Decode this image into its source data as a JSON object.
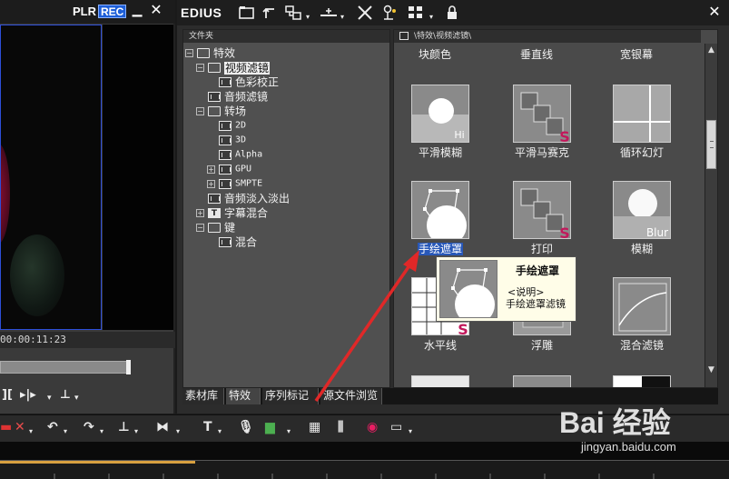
{
  "player": {
    "plr_label": "PLR",
    "rec_label": "REC",
    "timecode": "00:00:11:23",
    "progress_fraction": 0.76
  },
  "app": {
    "title": "EDIUS"
  },
  "folder_panel": {
    "header": "文件夹",
    "tree": [
      {
        "label": "特效",
        "icon": "folder-icon",
        "level": 0,
        "toggle": "−"
      },
      {
        "label": "视频滤镜",
        "icon": "folder-icon",
        "level": 1,
        "toggle": "−",
        "selected": true
      },
      {
        "label": "色彩校正",
        "icon": "film-icon",
        "level": 2
      },
      {
        "label": "音频滤镜",
        "icon": "film-icon",
        "level": 1
      },
      {
        "label": "转场",
        "icon": "folder-icon",
        "level": 1,
        "toggle": "−"
      },
      {
        "label": "2D",
        "icon": "film-icon",
        "level": 2
      },
      {
        "label": "3D",
        "icon": "film-icon",
        "level": 2
      },
      {
        "label": "Alpha",
        "icon": "film-icon",
        "level": 2
      },
      {
        "label": "GPU",
        "icon": "film-icon",
        "level": 2,
        "toggle": "+"
      },
      {
        "label": "SMPTE",
        "icon": "film-icon",
        "level": 2,
        "toggle": "+"
      },
      {
        "label": "音频淡入淡出",
        "icon": "film-icon",
        "level": 1
      },
      {
        "label": "字幕混合",
        "icon": "text-icon",
        "level": 1,
        "toggle": "+"
      },
      {
        "label": "键",
        "icon": "folder-icon",
        "level": 1,
        "toggle": "−"
      },
      {
        "label": "混合",
        "icon": "film-icon",
        "level": 2
      }
    ]
  },
  "effects_panel": {
    "header": "\\特效\\视频滤镜\\",
    "top_labels": [
      "块颜色",
      "垂直线",
      "宽银幕"
    ],
    "effects": [
      {
        "label": "平滑模糊",
        "thumb": "hi"
      },
      {
        "label": "平滑马赛克",
        "thumb": "squares-s"
      },
      {
        "label": "循环幻灯",
        "thumb": "grid"
      },
      {
        "label": "手绘遮罩",
        "thumb": "drawn-mask",
        "selected": true
      },
      {
        "label": "打印",
        "thumb": "squares-s"
      },
      {
        "label": "模糊",
        "thumb": "blur"
      },
      {
        "label": "水平线",
        "thumb": "lines-s"
      },
      {
        "label": "浮雕",
        "thumb": "emboss"
      },
      {
        "label": "混合滤镜",
        "thumb": "curve"
      }
    ],
    "thumb_text": {
      "hi": "Hi",
      "blur": "Blur",
      "s": "S"
    }
  },
  "tooltip": {
    "title": "手绘遮罩",
    "caption": "<说明>",
    "description": "手绘遮罩滤镜"
  },
  "tabs": [
    "素材库",
    "特效",
    "序列标记",
    "源文件浏览"
  ],
  "active_tab": 1,
  "watermark": {
    "logo": "Bai 经验",
    "url": "jingyan.baidu.com"
  },
  "colors": {
    "rec_badge": "#1e5fd8",
    "selection": "#2858b8",
    "arrow": "#e02828",
    "effect_s": "#c2185b"
  }
}
